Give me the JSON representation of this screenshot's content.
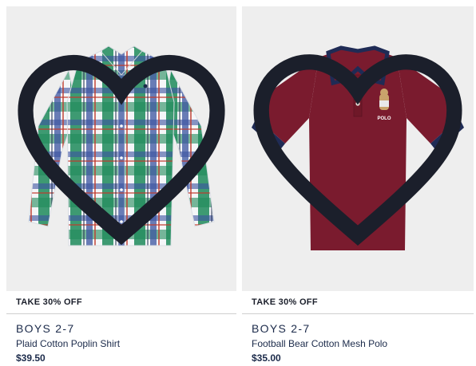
{
  "products": [
    {
      "promo": "TAKE 30% OFF",
      "category": "BOYS 2-7",
      "name": "Plaid Cotton Poplin Shirt",
      "price": "$39.50",
      "image": "plaid-shirt-image",
      "favorite_icon": "heart-outline-icon"
    },
    {
      "promo": "TAKE 30% OFF",
      "category": "BOYS 2-7",
      "name": "Football Bear Cotton Mesh Polo",
      "price": "$35.00",
      "image": "burgundy-polo-image",
      "favorite_icon": "heart-outline-icon",
      "logo_text": "POLO"
    }
  ],
  "colors": {
    "image_background": "#eeeeee",
    "text_navy": "#1b2a4a",
    "polo_burgundy": "#7a1b2e",
    "polo_trim_navy": "#1f2b55",
    "plaid_green": "#1f8a5a",
    "plaid_blue": "#3a52a0"
  }
}
